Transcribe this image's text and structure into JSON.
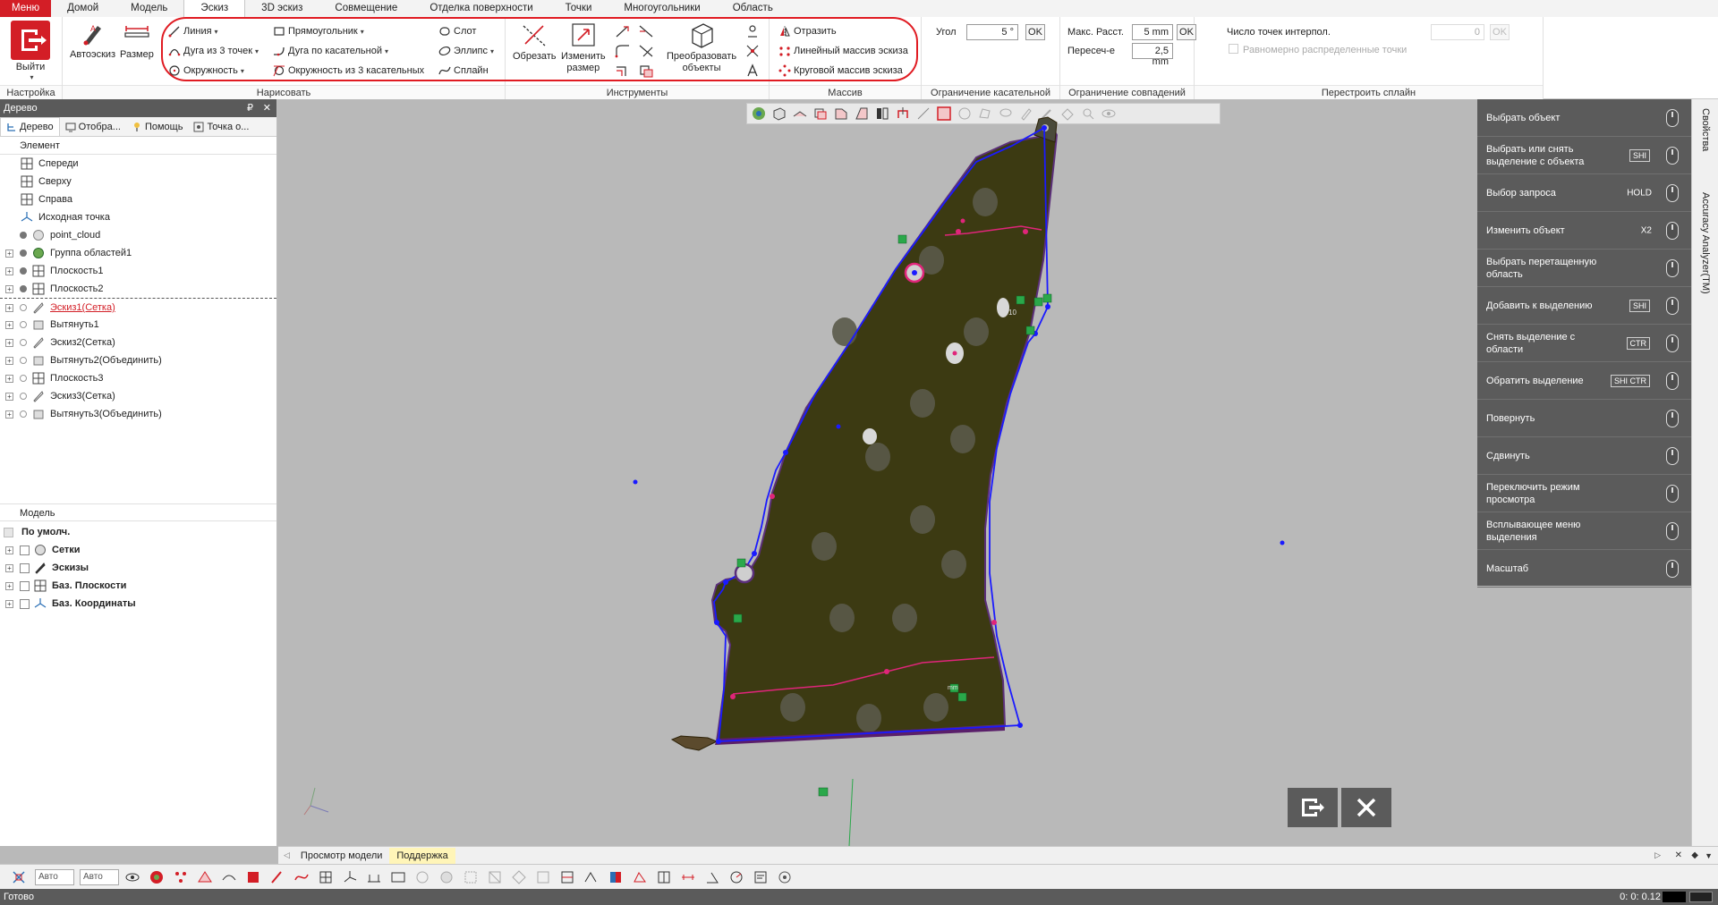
{
  "menubar": {
    "tabs": [
      "Меню",
      "Домой",
      "Модель",
      "Эскиз",
      "3D эскиз",
      "Совмещение",
      "Отделка поверхности",
      "Точки",
      "Многоугольники",
      "Область"
    ],
    "active": "Эскиз"
  },
  "ribbon": {
    "setup": {
      "exit_label": "Выйти",
      "group": "Настройка"
    },
    "draw": {
      "group": "Нарисовать",
      "autosketch": "Автоэскиз",
      "size": "Размер",
      "line": "Линия",
      "arc3": "Дуга из 3 точек",
      "circle": "Окружность",
      "rectangle": "Прямоугольник",
      "tangent_arc": "Дуга по касательной",
      "circle3tan": "Окружность из 3 касательных",
      "slot": "Слот",
      "ellipse": "Эллипс",
      "spline": "Сплайн"
    },
    "tools": {
      "group": "Инструменты",
      "trim": "Обрезать",
      "resize_1": "Изменить",
      "resize_2": "размер",
      "transform_1": "Преобразовать",
      "transform_2": "объекты"
    },
    "pattern": {
      "group": "Массив",
      "mirror": "Отразить",
      "linear": "Линейный массив эскиза",
      "circular": "Круговой массив эскиза"
    },
    "tangent": {
      "group": "Ограничение касательной",
      "angle_label": "Угол",
      "angle_value": "5 °",
      "ok": "OK"
    },
    "coincident": {
      "group": "Ограничение совпадений",
      "maxdist_label": "Макс. Расст.",
      "maxdist_value": "5 mm",
      "intersect_label": "Пересеч-е",
      "intersect_value": "2,5 mm",
      "ok": "OK"
    },
    "spline": {
      "group": "Перестроить сплайн",
      "points_label": "Число точек интерпол.",
      "points_value": "0",
      "ok": "OK",
      "uniform": "Равномерно распределенные точки"
    }
  },
  "left_panel": {
    "title": "Дерево",
    "pin": "₽",
    "close": "✕",
    "tabs": [
      "Дерево",
      "Отобра...",
      "Помощь",
      "Точка о..."
    ],
    "element_header": "Элемент",
    "tree": [
      {
        "label": "Спереди"
      },
      {
        "label": "Сверху"
      },
      {
        "label": "Справа"
      },
      {
        "label": "Исходная точка"
      },
      {
        "label": "point_cloud"
      },
      {
        "label": "Группа областей1"
      },
      {
        "label": "Плоскость1"
      },
      {
        "label": "Плоскость2"
      },
      {
        "label": "Эскиз1(Сетка)"
      },
      {
        "label": "Вытянуть1"
      },
      {
        "label": "Эскиз2(Сетка)"
      },
      {
        "label": "Вытянуть2(Объединить)"
      },
      {
        "label": "Плоскость3"
      },
      {
        "label": "Эскиз3(Сетка)"
      },
      {
        "label": "Вытянуть3(Объединить)"
      }
    ],
    "model_header": "Модель",
    "model": [
      {
        "label": "По умолч."
      },
      {
        "label": "Сетки"
      },
      {
        "label": "Эскизы"
      },
      {
        "label": "Баз. Плоскости"
      },
      {
        "label": "Баз. Координаты"
      }
    ]
  },
  "help_panel": [
    {
      "label": "Выбрать объект",
      "key": ""
    },
    {
      "label": "Выбрать или снять выделение с объекта",
      "key": "SHI"
    },
    {
      "label": "Выбор запроса",
      "key": "HOLD"
    },
    {
      "label": "Изменить объект",
      "key": "X2"
    },
    {
      "label": "Выбрать перетащенную область",
      "key": ""
    },
    {
      "label": "Добавить к выделению",
      "key": "SHI"
    },
    {
      "label": "Снять выделение с области",
      "key": "CTR"
    },
    {
      "label": "Обратить выделение",
      "key": "SHI CTR"
    },
    {
      "label": "Повернуть",
      "key": ""
    },
    {
      "label": "Сдвинуть",
      "key": ""
    },
    {
      "label": "Переключить режим просмотра",
      "key": ""
    },
    {
      "label": "Всплывающее меню выделения",
      "key": ""
    },
    {
      "label": "Масштаб",
      "key": ""
    }
  ],
  "side_tabs": [
    "Свойства",
    "Accuracy Analyzer(TM)"
  ],
  "viewport": {
    "dim_label": "10",
    "dim_label2": "mm"
  },
  "view_tabs": [
    "Просмотр модели",
    "Поддержка"
  ],
  "bottom": {
    "auto1": "Авто",
    "auto2": "Авто"
  },
  "status": {
    "text": "Готово",
    "time": "0: 0: 0.12"
  },
  "colors": {
    "accent": "#d31e26",
    "panel": "#5b5b5b",
    "part": "#3c3a12",
    "sketch": "#1a1aff",
    "constraint": "#e0257a"
  }
}
